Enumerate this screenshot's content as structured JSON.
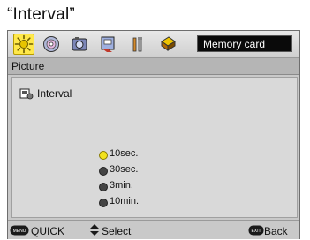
{
  "caption": "“Interval”",
  "toolbar": {
    "icons": [
      {
        "name": "sun-settings-icon",
        "selected": true
      },
      {
        "name": "disc-icon"
      },
      {
        "name": "camera-icon"
      },
      {
        "name": "document-icon"
      },
      {
        "name": "tools-icon"
      },
      {
        "name": "memory-card-icon"
      }
    ],
    "memory_card_label": "Memory card"
  },
  "section": {
    "title": "Picture"
  },
  "panel": {
    "heading": "Interval",
    "options": [
      {
        "label": "10sec.",
        "selected": true
      },
      {
        "label": "30sec.",
        "selected": false
      },
      {
        "label": "3min.",
        "selected": false
      },
      {
        "label": "10min.",
        "selected": false
      }
    ]
  },
  "footer": {
    "quick_button_text": "MENU",
    "quick_label": "QUICK",
    "select_label": "Select",
    "back_button_text": "EXIT",
    "back_label": "Back"
  },
  "colors": {
    "accent_yellow": "#ffe84a",
    "bar_black": "#0a0a0a",
    "panel_gray": "#d9d9d9"
  }
}
